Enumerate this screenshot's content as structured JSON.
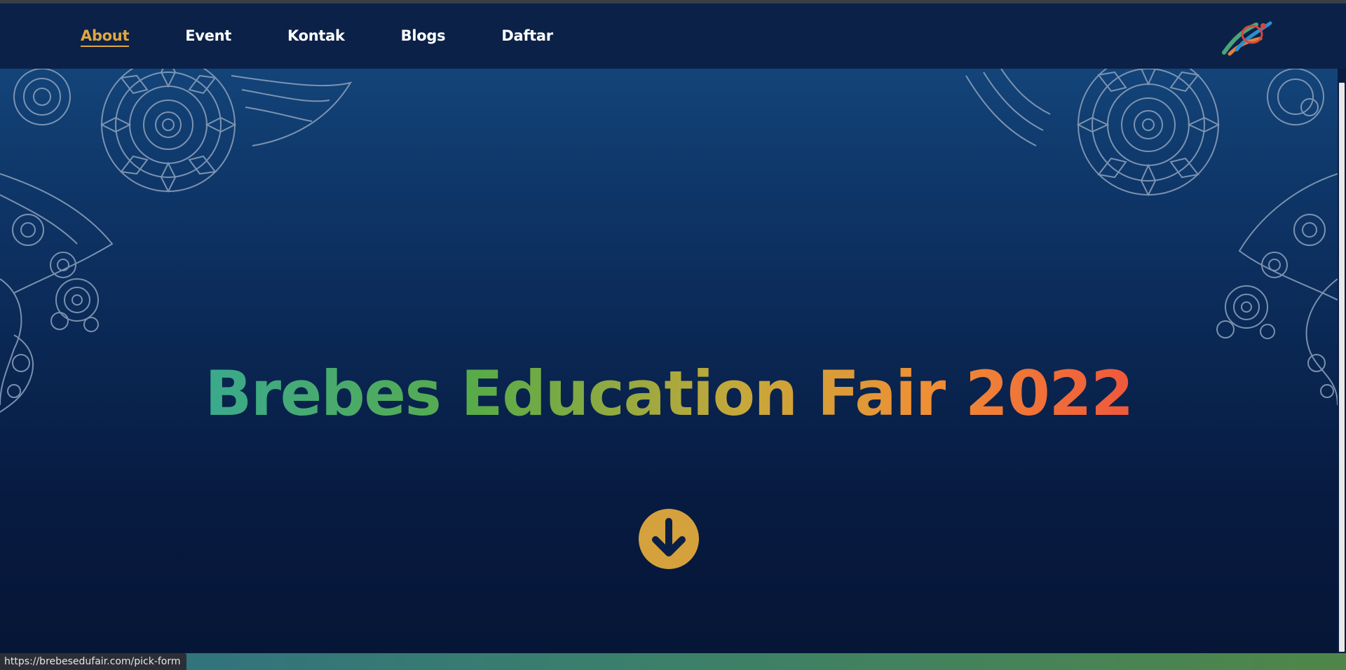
{
  "nav": {
    "items": [
      {
        "label": "About",
        "active": true
      },
      {
        "label": "Event",
        "active": false
      },
      {
        "label": "Kontak",
        "active": false
      },
      {
        "label": "Blogs",
        "active": false
      },
      {
        "label": "Daftar",
        "active": false
      }
    ],
    "logo_icon": "brand-logo-icon"
  },
  "hero": {
    "title": "Brebes Education Fair 2022",
    "scroll_icon": "arrow-down-icon"
  },
  "status": {
    "url": "https://brebesedufair.com/pick-form"
  },
  "colors": {
    "nav_background": "#0b2148",
    "active_link": "#e0a83d",
    "hero_top": "#134479",
    "hero_bottom": "#061636",
    "scroll_button": "#d4a13c",
    "title_gradient": [
      "#3aaa8d",
      "#5aab47",
      "#c7a83a",
      "#ef8f34",
      "#f0573c"
    ]
  }
}
